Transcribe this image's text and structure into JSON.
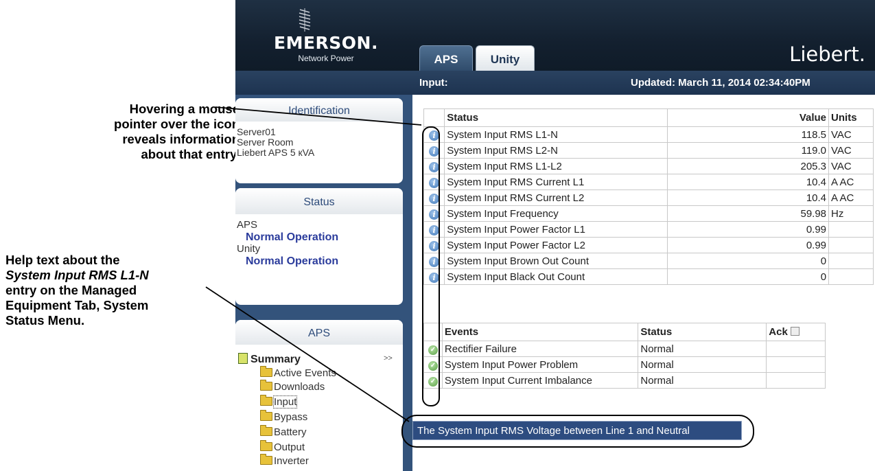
{
  "annotations": {
    "hover_note": [
      "Hovering a mouse",
      "pointer over the icon",
      "reveals information",
      "about that entry."
    ],
    "help_note": {
      "line1": "Help text about the",
      "line2_italic": "System Input RMS L1-N",
      "line3": "entry on the Managed",
      "line4": "Equipment Tab, System",
      "line5": "Status Menu."
    }
  },
  "header": {
    "logo_text": "EMERSON",
    "logo_dot": ".",
    "logo_subtitle": "Network Power",
    "brand": "Liebert.",
    "tabs": [
      {
        "label": "APS",
        "active": true
      },
      {
        "label": "Unity",
        "active": false
      }
    ],
    "section_label": "Input:",
    "updated": "Updated: March 11, 2014 02:34:40PM"
  },
  "sidebar": {
    "identification": {
      "title": "Identification",
      "lines": [
        "Server01",
        "Server Room",
        "Liebert APS 5 кVA"
      ]
    },
    "status": {
      "title": "Status",
      "entries": [
        {
          "device": "APS",
          "state": "Normal Operation"
        },
        {
          "device": "Unity",
          "state": "Normal Operation"
        }
      ]
    },
    "aps": {
      "title": "APS",
      "summary": "Summary",
      "expand": ">>",
      "items": [
        "Active Events",
        "Downloads",
        "Input",
        "Bypass",
        "Battery",
        "Output",
        "Inverter"
      ]
    }
  },
  "status_table": {
    "headers": {
      "status": "Status",
      "value": "Value",
      "units": "Units"
    },
    "rows": [
      {
        "label": "System Input RMS L1-N",
        "value": "118.5",
        "units": "VAC"
      },
      {
        "label": "System Input RMS L2-N",
        "value": "119.0",
        "units": "VAC"
      },
      {
        "label": "System Input RMS L1-L2",
        "value": "205.3",
        "units": "VAC"
      },
      {
        "label": "System Input RMS Current L1",
        "value": "10.4",
        "units": "A AC"
      },
      {
        "label": "System Input RMS Current L2",
        "value": "10.4",
        "units": "A AC"
      },
      {
        "label": "System Input Frequency",
        "value": "59.98",
        "units": "Hz"
      },
      {
        "label": "System Input Power Factor L1",
        "value": "0.99",
        "units": ""
      },
      {
        "label": "System Input Power Factor L2",
        "value": "0.99",
        "units": ""
      },
      {
        "label": "System Input Brown Out Count",
        "value": "0",
        "units": ""
      },
      {
        "label": "System Input Black Out Count",
        "value": "0",
        "units": ""
      }
    ]
  },
  "events_table": {
    "headers": {
      "events": "Events",
      "status": "Status",
      "ack": "Ack"
    },
    "rows": [
      {
        "label": "Rectifier Failure",
        "status": "Normal"
      },
      {
        "label": "System Input Power Problem",
        "status": "Normal"
      },
      {
        "label": "System Input Current Imbalance",
        "status": "Normal"
      }
    ]
  },
  "tooltip": "The System Input RMS Voltage between Line 1 and Neutral",
  "icons": {
    "info": "info-icon",
    "ok": "check-circle-icon",
    "folder": "folder-icon",
    "summary": "summary-page-icon"
  },
  "colors": {
    "header_bg": "#15212f",
    "sidebar_bg": "#33537b",
    "status_blue": "#2b3c9c",
    "tooltip_bg": "#2d4c80"
  }
}
